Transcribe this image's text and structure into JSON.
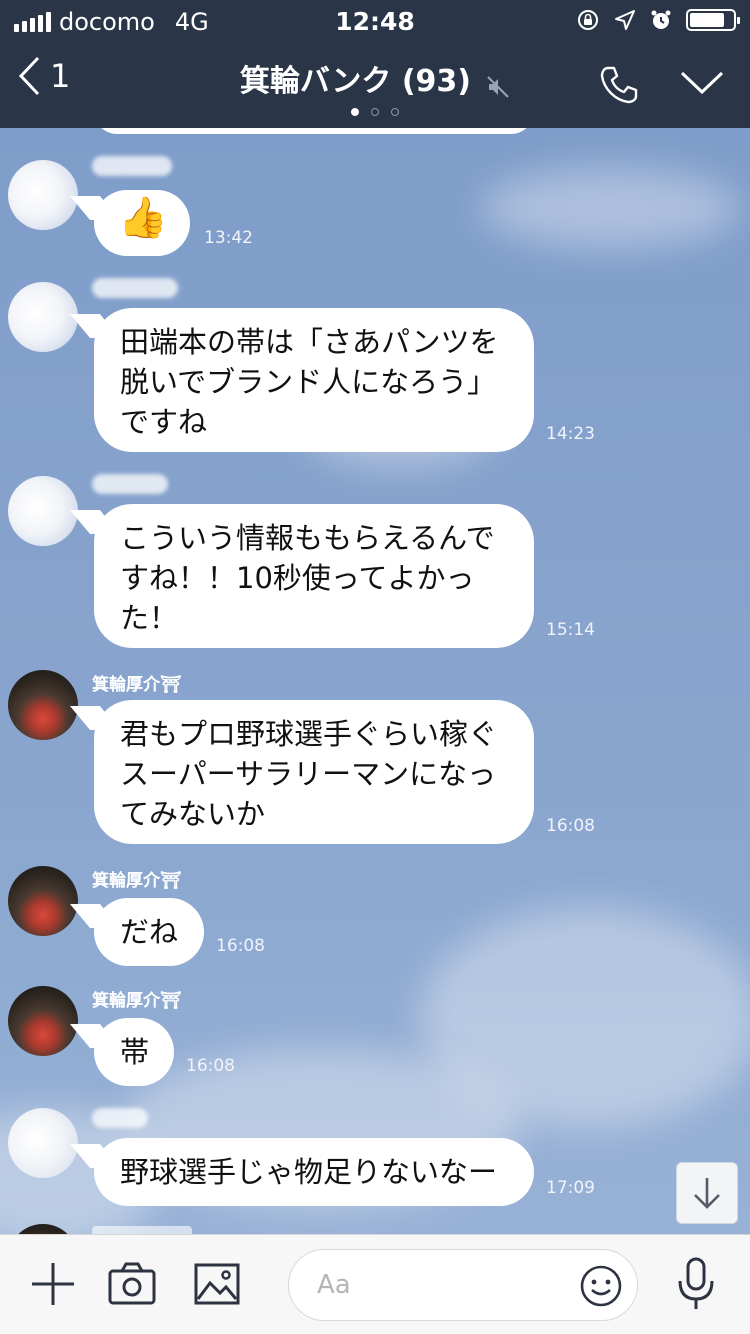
{
  "status_bar": {
    "carrier": "docomo",
    "network": "4G",
    "time": "12:48",
    "icons": [
      "signal-bars-icon",
      "orientation-lock-icon",
      "location-arrow-icon",
      "alarm-icon",
      "battery-icon"
    ]
  },
  "header": {
    "back_count": "1",
    "title": "箕輪バンク (93)",
    "icons": [
      "back-chevron-icon",
      "mute-icon",
      "phone-icon",
      "chevron-down-icon"
    ],
    "page_dots": 3,
    "active_dot": 0
  },
  "messages": [
    {
      "sender": "",
      "sender_hidden": true,
      "avatar": "blurred",
      "text": "👍",
      "time": "13:42"
    },
    {
      "sender": "",
      "sender_hidden": true,
      "avatar": "blurred",
      "text": "田端本の帯は「さあパンツを\n脱いでブランド人になろう」\nですね",
      "time": "14:23"
    },
    {
      "sender": "",
      "sender_hidden": true,
      "avatar": "blurred",
      "text": "こういう情報ももらえるんで\nすね！！10秒使ってよかっ\nた！",
      "time": "15:14"
    },
    {
      "sender": "箕輪厚介⛩",
      "avatar": "photo",
      "text": "君もプロ野球選手ぐらい稼ぐ\nスーパーサラリーマンになっ\nてみないか",
      "time": "16:08"
    },
    {
      "sender": "箕輪厚介⛩",
      "avatar": "photo",
      "text": "だね",
      "time": "16:08"
    },
    {
      "sender": "箕輪厚介⛩",
      "avatar": "photo",
      "text": "帯",
      "time": "16:08"
    },
    {
      "sender": "",
      "sender_hidden": true,
      "avatar": "blurred",
      "text": "野球選手じゃ物足りないなー",
      "time": "17:09"
    }
  ],
  "input_bar": {
    "placeholder": "Aa",
    "icons": [
      "plus-icon",
      "camera-icon",
      "image-icon",
      "emoji-icon",
      "microphone-icon"
    ]
  },
  "colors": {
    "header_bg": "#2b3548",
    "chat_bg": "#7f9dca",
    "bubble_bg": "#ffffff",
    "input_bar_bg": "#f7f7f7"
  }
}
